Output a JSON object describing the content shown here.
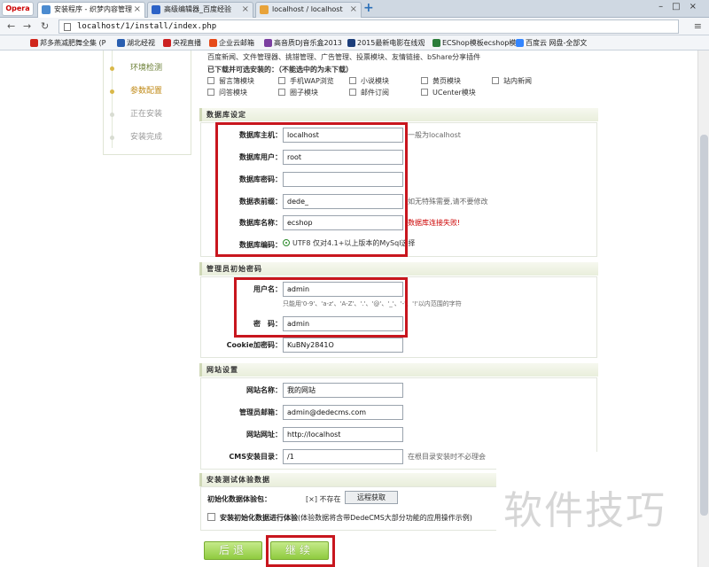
{
  "browser": {
    "menu_label": "Opera",
    "tabs": [
      {
        "title": "安装程序 - 织梦内容管理",
        "icon_color": "#4b8bd0"
      },
      {
        "title": "高级编辑器_百度经验",
        "icon_color": "#2d63c7"
      },
      {
        "title": "localhost / localhost",
        "icon_color": "#e8a33a"
      }
    ],
    "new_tab": "+",
    "url": "localhost/1/install/index.php",
    "bookmarks": [
      {
        "label": "邦多燕减肥舞全集 (P",
        "icon_color": "#d0271d"
      },
      {
        "label": "湖北经视",
        "icon_color": "#2a5fb0"
      },
      {
        "label": "央视直播",
        "icon_color": "#c22"
      },
      {
        "label": "企业云邮箱",
        "icon_color": "#e64a19"
      },
      {
        "label": "高音质DJ音乐盒2013",
        "icon_color": "#7b3fa0"
      },
      {
        "label": "2015最新电影在线观",
        "icon_color": "#1c3e7a"
      },
      {
        "label": "ECShop模板ecshop模",
        "icon_color": "#2c7d3a"
      },
      {
        "label": "百度云 网盘-全部文",
        "icon_color": "#3385ff"
      }
    ]
  },
  "steps": [
    {
      "label": "环境检测",
      "state": "done"
    },
    {
      "label": "参数配置",
      "state": "current"
    },
    {
      "label": "正在安装",
      "state": "future"
    },
    {
      "label": "安装完成",
      "state": "future"
    }
  ],
  "modules": {
    "intro": "百度新闻、文件管理器、挑错管理、广告管理、投票模块、友情链接、bShare分享插件",
    "note": "已下载并可选安装的：（不能选中的为未下载）",
    "items": [
      "留言簿模块",
      "手机WAP浏览",
      "小说模块",
      "黄页模块",
      "站内新闻",
      "问答模块",
      "圈子模块",
      "邮件订阅",
      "UCenter模块"
    ]
  },
  "db": {
    "title": "数据库设定",
    "host_label": "数据库主机：",
    "host": "localhost",
    "host_hint": "一般为localhost",
    "user_label": "数据库用户：",
    "user": "root",
    "pwd_label": "数据库密码：",
    "pwd": "",
    "prefix_label": "数据表前缀：",
    "prefix": "dede_",
    "prefix_hint": "如无特殊需要,请不要修改",
    "name_label": "数据库名称：",
    "name": "ecshop",
    "name_hint": "数据库连接失败!",
    "charset_label": "数据库编码：",
    "charset": "UTF8 仅对4.1+以上版本的MySql选择"
  },
  "admin": {
    "title": "管理员初始密码",
    "user_label": "用户名：",
    "user": "admin",
    "user_hint": "只能用'0-9'、'a-z'、'A-Z'、'.'、'@'、'_'、'-'、'!'以内范围的字符",
    "pwd_label": "密　码：",
    "pwd": "admin",
    "cookie_label": "Cookie加密码：",
    "cookie": "KuBNy2841O"
  },
  "site": {
    "title": "网站设置",
    "name_label": "网站名称：",
    "name": "我的网站",
    "email_label": "管理员邮箱：",
    "email": "admin@dedecms.com",
    "url_label": "网站网址：",
    "url": "http://localhost",
    "dir_label": "CMS安装目录：",
    "dir": "/1",
    "dir_hint": "在根目录安装时不必理会"
  },
  "sample": {
    "title": "安装测试体验数据",
    "init_label": "初始化数据体验包：",
    "init_status": "[×] 不存在",
    "remote_button": "远程获取",
    "check_bold": "安装初始化数据进行体验",
    "check_rest": "(体验数据将含带DedeCMS大部分功能的应用操作示例)"
  },
  "nav": {
    "back": "后退",
    "continue": "继续"
  },
  "watermark": "软件技巧",
  "colors": {
    "accent_green": "#8fcb3f",
    "highlight_red": "#c8161e",
    "error_red": "#cc0000"
  }
}
